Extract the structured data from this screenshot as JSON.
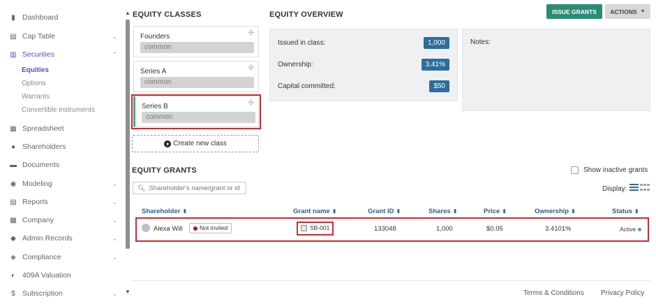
{
  "sidebar": {
    "items": [
      {
        "label": "Dashboard",
        "icon": "dashboard-icon"
      },
      {
        "label": "Cap Table",
        "icon": "cap-table-icon",
        "expandable": true
      },
      {
        "label": "Securities",
        "icon": "securities-icon",
        "expandable": true,
        "active": true
      },
      {
        "label": "Spreadsheet",
        "icon": "spreadsheet-icon"
      },
      {
        "label": "Shareholders",
        "icon": "user-icon"
      },
      {
        "label": "Documents",
        "icon": "folder-icon"
      },
      {
        "label": "Modeling",
        "icon": "lightbulb-icon",
        "expandable": true
      },
      {
        "label": "Reports",
        "icon": "report-icon",
        "expandable": true
      },
      {
        "label": "Company",
        "icon": "company-icon",
        "expandable": true
      },
      {
        "label": "Admin Records",
        "icon": "admin-icon",
        "expandable": true
      },
      {
        "label": "Compliance",
        "icon": "compliance-icon",
        "expandable": true
      },
      {
        "label": "409A Valuation",
        "icon": "valuation-icon"
      },
      {
        "label": "Subscription",
        "icon": "dollar-icon",
        "expandable": true
      }
    ],
    "securities_sub": [
      "Equities",
      "Options",
      "Warrants",
      "Convertible instruments"
    ]
  },
  "equity_classes": {
    "title": "EQUITY CLASSES",
    "classes": [
      {
        "name": "Founders",
        "type": "common"
      },
      {
        "name": "Series A",
        "type": "common"
      },
      {
        "name": "Series B",
        "type": "common"
      }
    ],
    "create_label": "Create new class"
  },
  "overview": {
    "title": "EQUITY OVERVIEW",
    "issued_label": "Issued in class:",
    "issued_value": "1,000",
    "ownership_label": "Ownership:",
    "ownership_value": "3.41%",
    "capital_label": "Capital committed:",
    "capital_value": "$50",
    "notes_label": "Notes:"
  },
  "header_buttons": {
    "issue": "ISSUE GRANTS",
    "actions": "ACTIONS"
  },
  "grants": {
    "title": "EQUITY GRANTS",
    "show_inactive": "Show inactive grants",
    "search_placeholder": "Shareholder's name/grant or id",
    "display_label": "Display:",
    "columns": [
      "Shareholder",
      "Grant name",
      "Grant ID",
      "Shares",
      "Price",
      "Ownership",
      "Status"
    ],
    "rows": [
      {
        "shareholder": "Alexa Will",
        "invite_status": "Not invited",
        "grant_name": "SB-001",
        "grant_id": "133048",
        "shares": "1,000",
        "price": "$0.05",
        "ownership": "3.4101%",
        "status": "Active"
      }
    ]
  },
  "footer": {
    "terms": "Terms & Conditions",
    "privacy": "Privacy Policy"
  },
  "colors": {
    "accent_purple": "#6a44b8",
    "issue_button": "#2a8c77",
    "badge_blue": "#2a6e9b",
    "highlight_red": "#d0282f",
    "active_green": "#3dab8f"
  }
}
